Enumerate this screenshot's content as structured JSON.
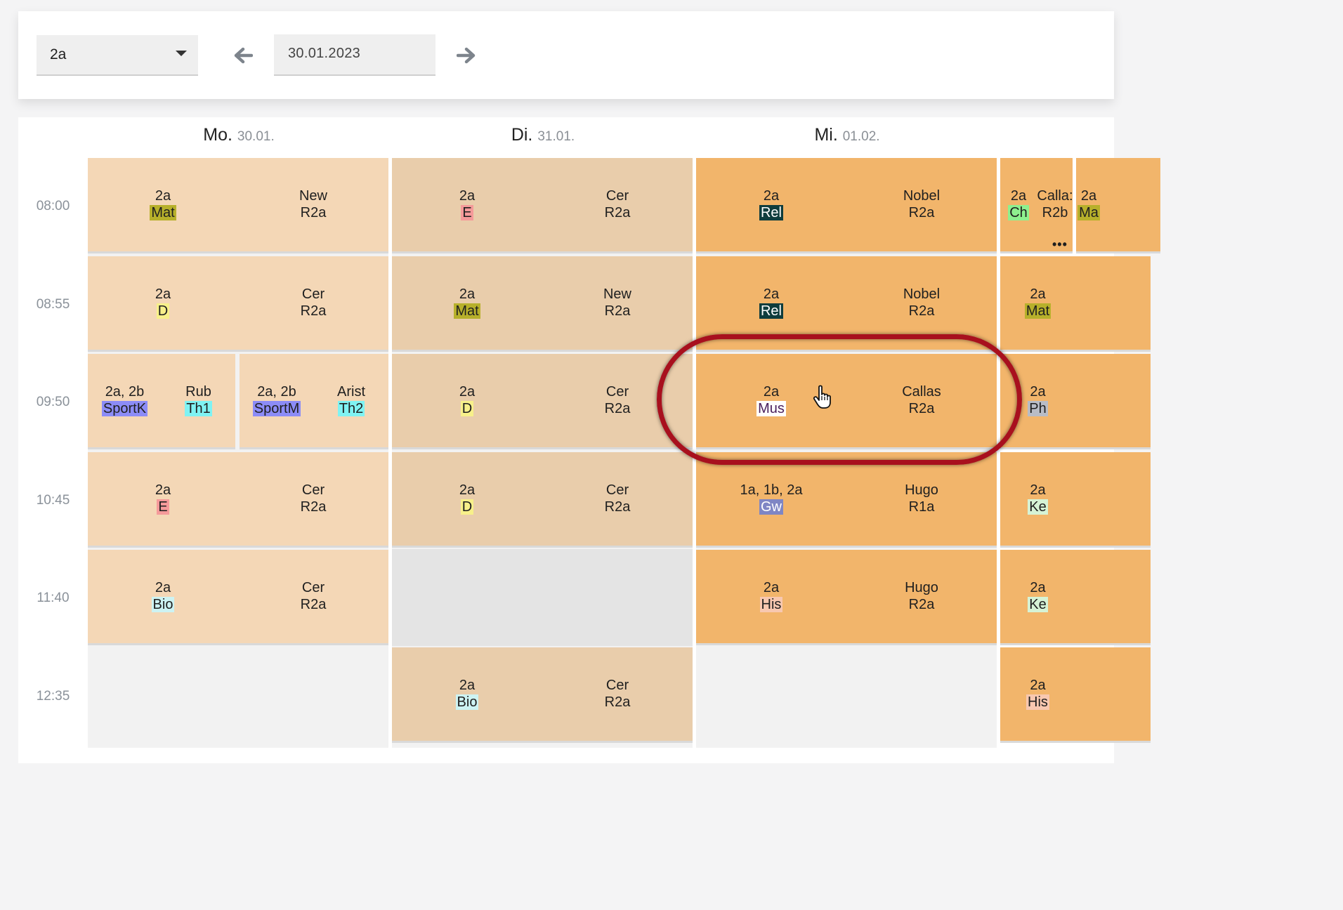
{
  "toolbar": {
    "class_select": {
      "value": "2a"
    },
    "date": "30.01.2023"
  },
  "days": [
    {
      "name": "Mo.",
      "date": "30.01."
    },
    {
      "name": "Di.",
      "date": "31.01."
    },
    {
      "name": "Mi.",
      "date": "01.02."
    }
  ],
  "times": [
    "08:00",
    "08:55",
    "09:50",
    "10:45",
    "11:40",
    "12:35"
  ],
  "colors": {
    "mon_bg": "#f4d7b6",
    "tue_bg": "#e9cdab",
    "wed_bg": "#f2b56b",
    "empty_mon": "#f2f2f2",
    "empty_tue": "#e6e6e6",
    "highlight": "#a8101e"
  },
  "monday": [
    {
      "cls": "2a",
      "subject": "Mat",
      "subject_color": "#b7b02b",
      "teacher": "New",
      "room": "R2a"
    },
    {
      "cls": "2a",
      "subject": "D",
      "subject_color": "#f7f08a",
      "teacher": "Cer",
      "room": "R2a"
    },
    {
      "cls": "2a, 2b",
      "subject": "SportK",
      "subject_color": "#8c8cf7",
      "teacher": "Rub",
      "room": "Th1",
      "room_color": "#7ff3f3"
    },
    {
      "cls": "2a, 2b",
      "subject": "SportM",
      "subject_color": "#8c8cf7",
      "teacher": "Arist",
      "room": "Th2",
      "room_color": "#7ff3f3"
    },
    {
      "cls": "2a",
      "subject": "E",
      "subject_color": "#f59a9a",
      "teacher": "Cer",
      "room": "R2a"
    },
    {
      "cls": "2a",
      "subject": "Bio",
      "subject_color": "#cdf3f3",
      "teacher": "Cer",
      "room": "R2a"
    }
  ],
  "tuesday": [
    {
      "cls": "2a",
      "subject": "E",
      "subject_color": "#f59a9a",
      "teacher": "Cer",
      "room": "R2a"
    },
    {
      "cls": "2a",
      "subject": "Mat",
      "subject_color": "#b7b02b",
      "teacher": "New",
      "room": "R2a"
    },
    {
      "cls": "2a",
      "subject": "D",
      "subject_color": "#f7f08a",
      "teacher": "Cer",
      "room": "R2a"
    },
    {
      "cls": "2a",
      "subject": "D",
      "subject_color": "#f7f08a",
      "teacher": "Cer",
      "room": "R2a"
    },
    {
      "cls": "2a",
      "subject": "Bio",
      "subject_color": "#cdf3f3",
      "teacher": "Cer",
      "room": "R2a"
    }
  ],
  "wednesday": [
    {
      "cls": "2a",
      "subject": "Rel",
      "subject_color": "#0f3d3d",
      "subject_text": "#ffffff",
      "teacher": "Nobel",
      "room": "R2a"
    },
    {
      "cls": "2a",
      "subject": "Rel",
      "subject_color": "#0f3d3d",
      "subject_text": "#ffffff",
      "teacher": "Nobel",
      "room": "R2a"
    },
    {
      "cls": "2a",
      "subject": "Mus",
      "subject_color": "#ffffff",
      "subject_text": "#4a1f5c",
      "teacher": "Callas",
      "room": "R2a"
    },
    {
      "cls": "1a, 1b, 2a",
      "subject": "Gw",
      "subject_color": "#7f86c4",
      "subject_text": "#ffffff",
      "teacher": "Hugo",
      "room": "R1a"
    },
    {
      "cls": "2a",
      "subject": "His",
      "subject_color": "#f8c8b0",
      "teacher": "Hugo",
      "room": "R2a"
    }
  ],
  "thursday": [
    {
      "cls": "2a",
      "subject": "Ch",
      "subject_color": "#8ef08e",
      "teacher": "Calla:",
      "room": "R2b"
    },
    {
      "cls": "2a",
      "subject": "Ma",
      "subject_color": "#b7b02b"
    },
    {
      "cls": "2a",
      "subject": "Mat",
      "subject_color": "#b7b02b"
    },
    {
      "cls": "2a",
      "subject": "Ph",
      "subject_color": "#b8bcc6"
    },
    {
      "cls": "2a",
      "subject": "Ke",
      "subject_color": "#d6f3d6"
    },
    {
      "cls": "2a",
      "subject": "Ke",
      "subject_color": "#d6f3d6"
    },
    {
      "cls": "2a",
      "subject": "His",
      "subject_color": "#f8c8b0"
    }
  ],
  "more_indicator": "•••"
}
